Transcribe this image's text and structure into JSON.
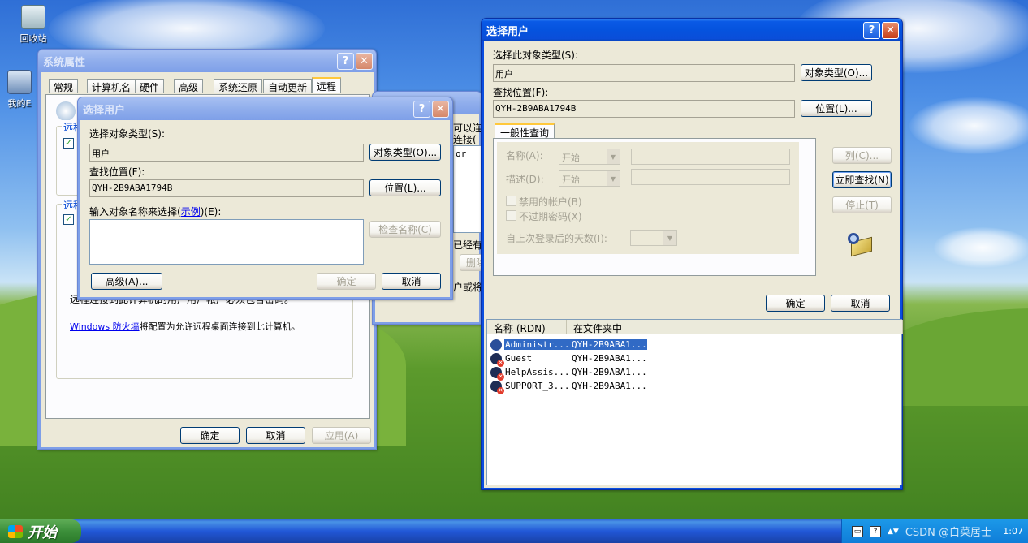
{
  "desktop": {
    "icons": [
      {
        "label": "回收站",
        "icon": "recycle-bin-icon"
      },
      {
        "label": "我的E",
        "icon": "my-computer-icon"
      }
    ]
  },
  "sysprops": {
    "title": "系统属性",
    "tabs": [
      "常规",
      "计算机名",
      "硬件",
      "高级",
      "系统还原",
      "自动更新",
      "远程"
    ],
    "active_tab": "远程",
    "group1_label": "远程",
    "group2_label": "远程",
    "password_note": "远程连接到此计算机的用户用户帐户必须包含密码。",
    "firewall_link": "Windows 防火墙",
    "firewall_text": "将配置为允许远程桌面连接到此计算机。",
    "ok": "确定",
    "cancel": "取消",
    "apply": "应用(A)"
  },
  "remote_users": {
    "frag1": "可以连",
    "frag2": "连接(",
    "frag3": "or",
    "frag4": "已经有",
    "frag5": "删除",
    "frag6": "户或将"
  },
  "small_dialog": {
    "title": "选择用户",
    "object_type_label": "选择对象类型(S):",
    "object_type_value": "用户",
    "object_type_btn": "对象类型(O)...",
    "location_label": "查找位置(F):",
    "location_value": "QYH-2B9ABA1794B",
    "location_btn": "位置(L)...",
    "enter_label_pre": "输入对象名称来选择(",
    "enter_label_link": "示例",
    "enter_label_post": ")(E):",
    "check_names_btn": "检查名称(C)",
    "advanced_btn": "高级(A)...",
    "ok": "确定",
    "cancel": "取消"
  },
  "big_dialog": {
    "title": "选择用户",
    "object_type_label": "选择此对象类型(S):",
    "object_type_value": "用户",
    "object_type_btn": "对象类型(O)...",
    "location_label": "查找位置(F):",
    "location_value": "QYH-2B9ABA1794B",
    "location_btn": "位置(L)...",
    "tab_general": "一般性查询",
    "name_label": "名称(A):",
    "desc_label": "描述(D):",
    "starts_with": "开始",
    "disabled_accounts": "禁用的帐户(B)",
    "non_expiring": "不过期密码(X)",
    "days_label": "自上次登录后的天数(I):",
    "columns_btn": "列(C)...",
    "find_now_btn": "立即查找(N)",
    "stop_btn": "停止(T)",
    "ok": "确定",
    "cancel": "取消",
    "list_headers": [
      "名称 (RDN)",
      "在文件夹中"
    ],
    "results": [
      {
        "name": "Administr...",
        "folder": "QYH-2B9ABA1...",
        "selected": true,
        "disabled": false
      },
      {
        "name": "Guest",
        "folder": "QYH-2B9ABA1...",
        "selected": false,
        "disabled": true
      },
      {
        "name": "HelpAssis...",
        "folder": "QYH-2B9ABA1...",
        "selected": false,
        "disabled": true
      },
      {
        "name": "SUPPORT_3...",
        "folder": "QYH-2B9ABA1...",
        "selected": false,
        "disabled": true
      }
    ]
  },
  "taskbar": {
    "start": "开始",
    "watermark": "CSDN @白菜居士",
    "clock": "1:07"
  },
  "colors": {
    "xp_blue": "#0a4ee0",
    "xp_face": "#ece9d8",
    "selection": "#316ac5",
    "start_green": "#3c8f3a"
  }
}
